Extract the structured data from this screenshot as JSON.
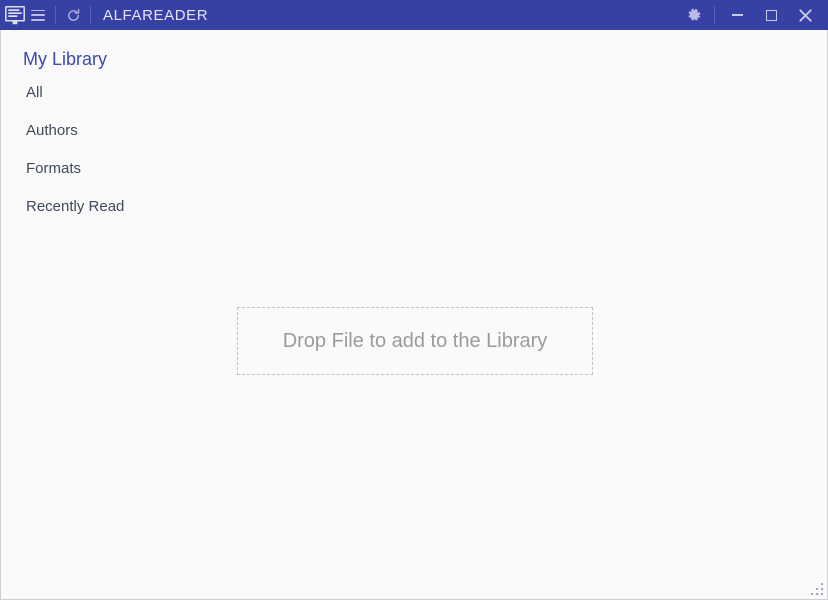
{
  "window": {
    "app_title": "ALFAREADER",
    "titlebar_color": "#3740a5",
    "background_color": "#fafafa"
  },
  "titlebar": {
    "app_icon": "reader-monitor-icon",
    "menu_icon": "hamburger-menu-icon",
    "refresh_icon": "refresh-icon",
    "settings_icon": "gear-icon",
    "minimize_icon": "minimize-icon",
    "maximize_icon": "maximize-icon",
    "close_icon": "close-icon"
  },
  "sidebar": {
    "title": "My Library",
    "title_color": "#3b48b5",
    "items": [
      {
        "label": "All"
      },
      {
        "label": "Authors"
      },
      {
        "label": "Formats"
      },
      {
        "label": "Recently Read"
      }
    ]
  },
  "main": {
    "dropzone_text": "Drop File to add to the Library",
    "dropzone_text_color": "#9b9b9b",
    "dropzone_border_color": "#c2c2c2"
  },
  "statusbar": {
    "resize_grip": "resize-grip-icon"
  }
}
